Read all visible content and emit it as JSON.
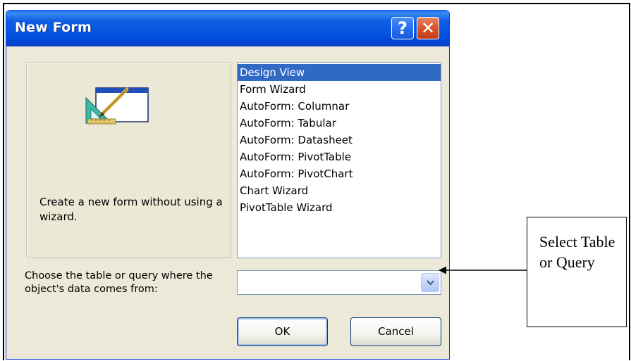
{
  "dialog": {
    "title": "New Form",
    "help_button": "?",
    "close_button": "✕",
    "description": "Create a new form without using a wizard.",
    "list_items": [
      "Design View",
      "Form Wizard",
      "AutoForm:  Columnar",
      "AutoForm:  Tabular",
      "AutoForm:  Datasheet",
      "AutoForm:  PivotTable",
      "AutoForm:  PivotChart",
      "Chart Wizard",
      "PivotTable Wizard"
    ],
    "selected_item": "Design View",
    "source_label": "Choose the table or query where the object's data comes from:",
    "source_value": "",
    "ok_label": "OK",
    "cancel_label": "Cancel"
  },
  "annotation": {
    "callout_text": "Select Table or Query"
  },
  "icons": {
    "form_icon": "design-form-icon",
    "dropdown_icon": "chevron-down-icon"
  },
  "colors": {
    "title_bar": "#0454e0",
    "selection": "#316ac5",
    "dialog_bg": "#ece9d8",
    "close_button": "#d8542d"
  }
}
